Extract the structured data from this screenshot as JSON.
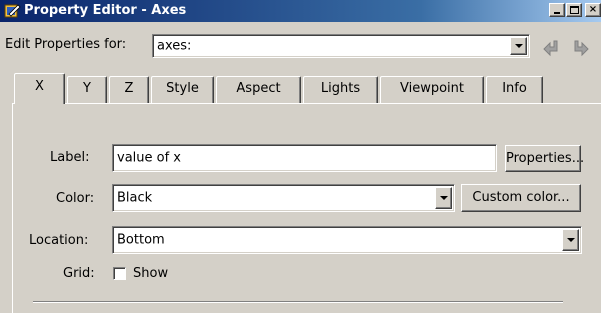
{
  "window": {
    "title": "Property Editor - Axes",
    "minimize_glyph": "_",
    "close_glyph": "×"
  },
  "toolbar": {
    "edit_label": "Edit Properties for:",
    "object_value": "axes:",
    "back_icon": "back-arrow-icon",
    "forward_icon": "forward-arrow-icon"
  },
  "tabs": [
    {
      "label": "X",
      "active": true
    },
    {
      "label": "Y",
      "active": false
    },
    {
      "label": "Z",
      "active": false
    },
    {
      "label": "Style",
      "active": false
    },
    {
      "label": "Aspect",
      "active": false
    },
    {
      "label": "Lights",
      "active": false
    },
    {
      "label": "Viewpoint",
      "active": false
    },
    {
      "label": "Info",
      "active": false
    }
  ],
  "form": {
    "label": {
      "caption": "Label:",
      "value": "value of x",
      "button": "Properties..."
    },
    "color": {
      "caption": "Color:",
      "value": "Black",
      "button": "Custom color..."
    },
    "location": {
      "caption": "Location:",
      "value": "Bottom"
    },
    "grid": {
      "caption": "Grid:",
      "checkbox_label": "Show",
      "checked": false
    }
  },
  "colors": {
    "face": "#d4d0c8",
    "title_start": "#0a246a",
    "title_end": "#a6caf0"
  }
}
